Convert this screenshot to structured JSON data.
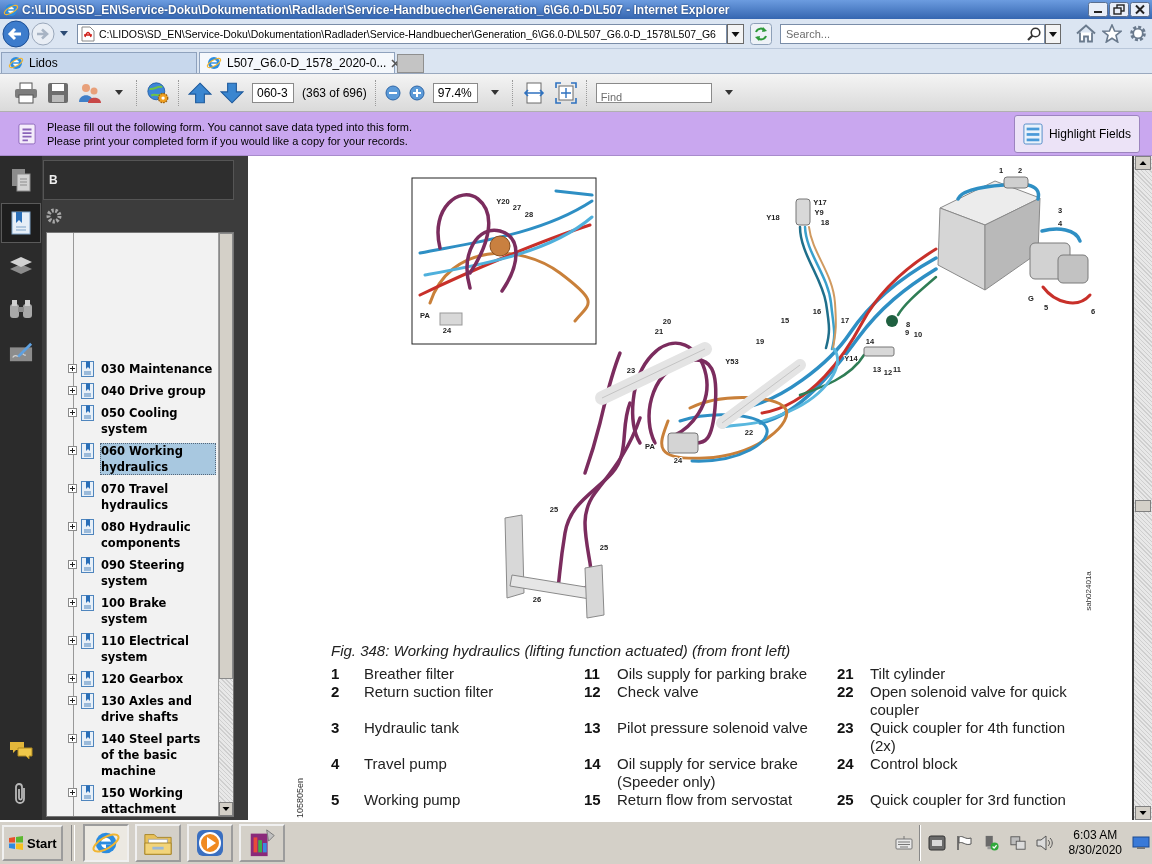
{
  "window": {
    "title": "C:\\LIDOS\\SD_EN\\Service-Doku\\Dokumentation\\Radlader\\Service-Handbuecher\\Generation_6\\G6.0-D\\L507 - Internet Explorer"
  },
  "address_bar": {
    "url": "C:\\LIDOS\\SD_EN\\Service-Doku\\Dokumentation\\Radlader\\Service-Handbuecher\\Generation_6\\G6.0-D\\L507_G6.0-D_1578\\L507_G6",
    "search": {
      "placeholder": "Search..."
    }
  },
  "tabs": [
    {
      "label": "Lidos",
      "selected": false
    },
    {
      "label": "L507_G6.0-D_1578_2020-0...",
      "selected": true
    }
  ],
  "reader_toolbar": {
    "page": "060-3",
    "page_count": "(363 of 696)",
    "zoom": "97.4%",
    "find": {
      "placeholder": "Find"
    }
  },
  "form_bar": {
    "lines": [
      "Please fill out the following form. You cannot save data typed into this form.",
      "Please print your completed form if you would like a copy for your records."
    ],
    "button": "Highlight Fields"
  },
  "sidebar": {
    "tools": [
      {
        "kind": "pages",
        "selected": false
      },
      {
        "kind": "bookmarks",
        "selected": true
      },
      {
        "kind": "layers",
        "selected": false
      },
      {
        "kind": "search",
        "selected": false
      },
      {
        "kind": "sign",
        "selected": false
      }
    ],
    "bottom_tools": [
      {
        "kind": "comments",
        "selected": false
      },
      {
        "kind": "attachments",
        "selected": false
      }
    ],
    "panel_title": "B",
    "bookmarks": [
      {
        "label": "030 Maintenance",
        "expanded": false,
        "selected": false
      },
      {
        "label": "040 Drive group",
        "expanded": false,
        "selected": false
      },
      {
        "label": "050 Cooling system",
        "expanded": false,
        "selected": false
      },
      {
        "label": "060 Working hydraulics",
        "expanded": false,
        "selected": true
      },
      {
        "label": "070 Travel hydraulics",
        "expanded": false,
        "selected": false
      },
      {
        "label": "080 Hydraulic components",
        "expanded": false,
        "selected": false
      },
      {
        "label": "090 Steering system",
        "expanded": false,
        "selected": false
      },
      {
        "label": "100 Brake system",
        "expanded": false,
        "selected": false
      },
      {
        "label": "110 Electrical system",
        "expanded": false,
        "selected": false
      },
      {
        "label": "120 Gearbox",
        "expanded": false,
        "selected": false
      },
      {
        "label": "130 Axles and drive shafts",
        "expanded": false,
        "selected": false
      },
      {
        "label": "140 Steel parts of the basic machine",
        "expanded": false,
        "selected": false
      },
      {
        "label": "150 Working attachment",
        "expanded": false,
        "selected": false
      }
    ]
  },
  "document": {
    "figure": {
      "callouts": [
        "1",
        "2",
        "3",
        "4",
        "G",
        "5",
        "6",
        "Y17",
        "Y9",
        "Y18",
        "18",
        "15",
        "16",
        "17",
        "8",
        "9",
        "10",
        "14",
        "Y14",
        "13",
        "12",
        "11",
        "19",
        "20",
        "21",
        "23",
        "Y53",
        "22",
        "PA",
        "24",
        "25",
        "25",
        "26"
      ],
      "inset_callouts": [
        "Y20",
        "27",
        "28",
        "PA",
        "24"
      ],
      "code": "sah02401a"
    },
    "caption": "Fig. 348: Working hydraulics (lifting function actuated) (from front left)",
    "legend": [
      {
        "number": "1",
        "text": "Breather filter"
      },
      {
        "number": "2",
        "text": "Return suction filter"
      },
      {
        "number": "3",
        "text": "Hydraulic tank"
      },
      {
        "number": "4",
        "text": "Travel pump"
      },
      {
        "number": "5",
        "text": "Working pump"
      },
      {
        "number": "11",
        "text": "Oils supply for parking brake"
      },
      {
        "number": "12",
        "text": "Check valve"
      },
      {
        "number": "13",
        "text": "Pilot pressure solenoid valve"
      },
      {
        "number": "14",
        "text": "Oil supply for service brake (Speeder only)"
      },
      {
        "number": "15",
        "text": "Return flow from servostat"
      },
      {
        "number": "21",
        "text": "Tilt cylinder"
      },
      {
        "number": "22",
        "text": "Open solenoid valve for quick coupler"
      },
      {
        "number": "23",
        "text": "Quick coupler for 4th function (2x)"
      },
      {
        "number": "24",
        "text": "Control block"
      },
      {
        "number": "25",
        "text": "Quick coupler for 3rd function"
      }
    ],
    "margin_code": "105805en"
  },
  "taskbar": {
    "start": "Start",
    "apps": [
      {
        "kind": "browser",
        "selected": true
      },
      {
        "kind": "folder",
        "selected": false
      },
      {
        "kind": "media",
        "selected": false
      },
      {
        "kind": "installer",
        "selected": false
      }
    ],
    "time": "6:03 AM",
    "date": "8/30/2020"
  }
}
